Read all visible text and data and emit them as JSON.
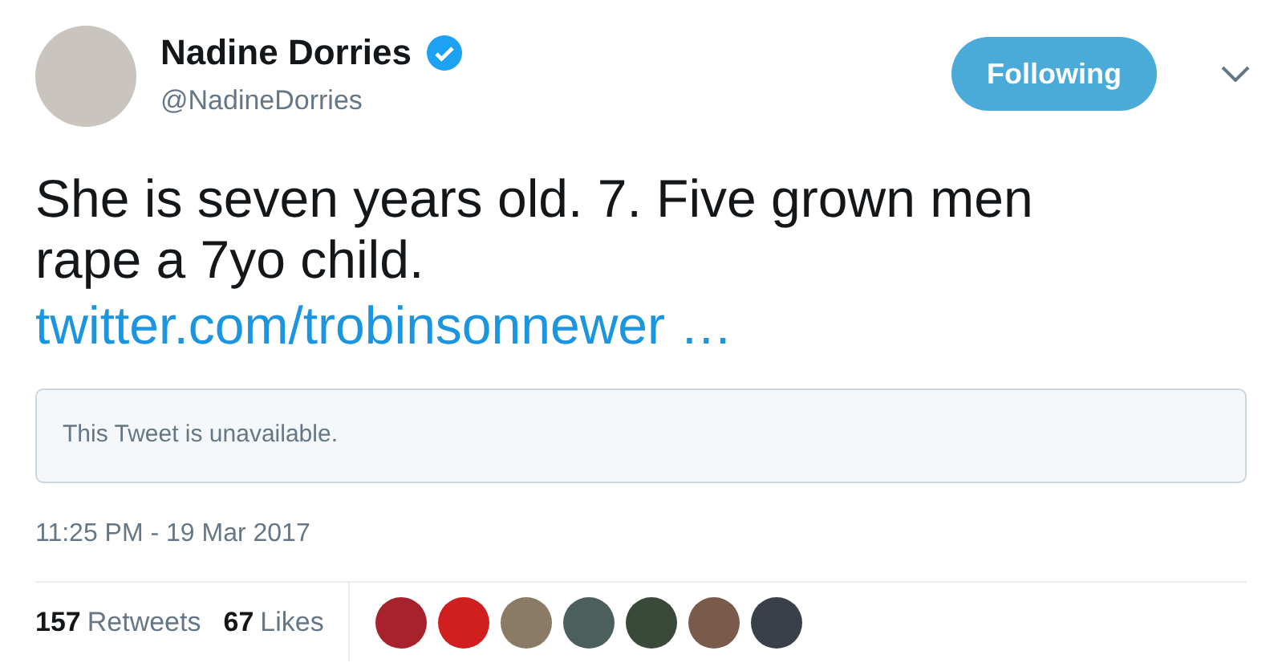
{
  "author": {
    "name": "Nadine Dorries",
    "verified": true,
    "handle": "@NadineDorries"
  },
  "follow_button": {
    "label": "Following",
    "selected": true
  },
  "tweet": {
    "text_lines": [
      "She is seven years old. 7. Five grown men",
      "rape a 7yo child."
    ],
    "link": "twitter.com/trobinsonnewer …"
  },
  "quoted_card": {
    "text": "This Tweet is unavailable."
  },
  "timestamp": "11:25 PM - 19 Mar 2017",
  "stats": [
    {
      "count": "157",
      "label": "Retweets"
    },
    {
      "count": "67",
      "label": "Likes"
    }
  ],
  "likers": [
    {
      "color": "#a8222e"
    },
    {
      "color": "#d11f1f"
    },
    {
      "color": "#8a7a66"
    },
    {
      "color": "#4d5f5c"
    },
    {
      "color": "#3a4a3a"
    },
    {
      "color": "#7a5a4a"
    },
    {
      "color": "#3a3f4a"
    }
  ]
}
